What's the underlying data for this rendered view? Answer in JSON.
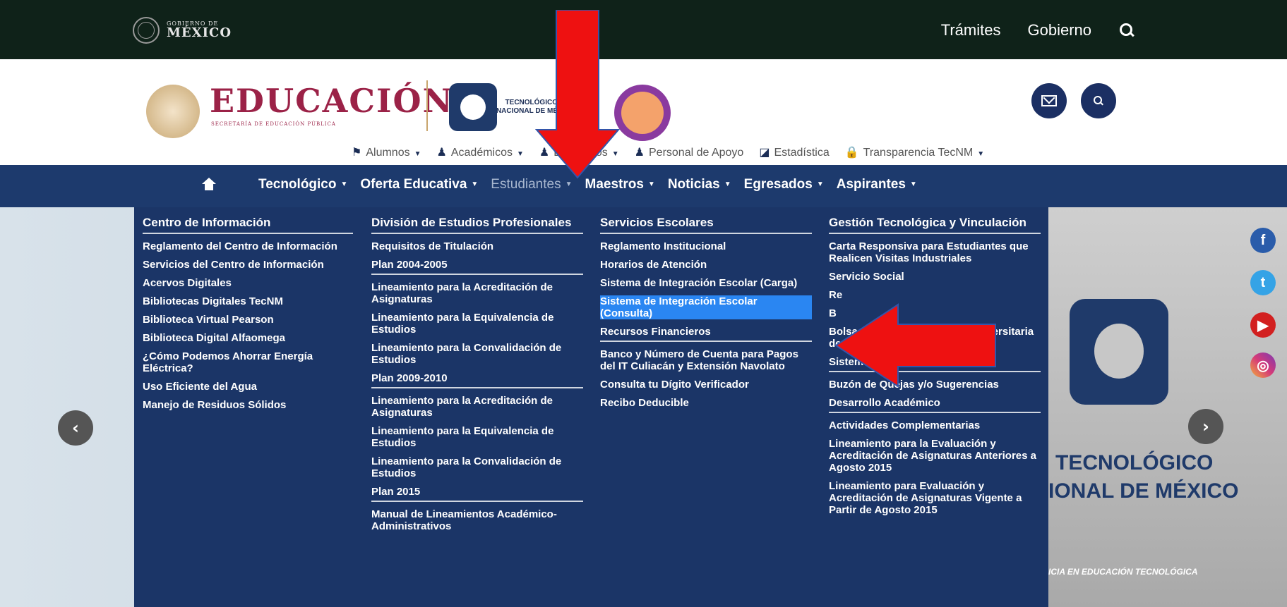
{
  "gov": {
    "logo_small": "GOBIERNO DE",
    "logo_big": "MÉXICO",
    "nav": [
      "Trámites",
      "Gobierno"
    ]
  },
  "header": {
    "edu_title": "EDUCACIÓN",
    "edu_sub": "SECRETARÍA DE EDUCACIÓN PÚBLICA",
    "tec_name": "TECNOLÓGICO NACIONAL DE MÉ"
  },
  "subnav": [
    {
      "label": "Alumnos",
      "icon": "flag-icon",
      "caret": true
    },
    {
      "label": "Académicos",
      "icon": "person-icon",
      "caret": true
    },
    {
      "label": "Egresados",
      "icon": "person-icon",
      "caret": true
    },
    {
      "label": "Personal de Apoyo",
      "icon": "person-icon",
      "caret": false
    },
    {
      "label": "Estadística",
      "icon": "chart-icon",
      "caret": false
    },
    {
      "label": "Transparencia TecNM",
      "icon": "lock-icon",
      "caret": true
    }
  ],
  "mainnav": [
    {
      "label": "Tecnológico",
      "active": false
    },
    {
      "label": "Oferta Educativa",
      "active": false
    },
    {
      "label": "Estudiantes",
      "active": true
    },
    {
      "label": "Maestros",
      "active": false
    },
    {
      "label": "Noticias",
      "active": false
    },
    {
      "label": "Egresados",
      "active": false
    },
    {
      "label": "Aspirantes",
      "active": false
    }
  ],
  "dropdown": {
    "col1": {
      "title": "Centro de Información",
      "items": [
        "Reglamento del Centro de Información",
        "Servicios del Centro de Información",
        "Acervos Digitales",
        "Bibliotecas Digitales TecNM",
        "Biblioteca Virtual Pearson",
        "Biblioteca Digital Alfaomega",
        "¿Cómo Podemos Ahorrar Energía Eléctrica?",
        "Uso Eficiente del Agua",
        "Manejo de Residuos Sólidos"
      ]
    },
    "col2": {
      "title": "División de Estudios Profesionales",
      "items": [
        {
          "t": "Requisitos de Titulación",
          "s": false
        },
        {
          "t": "Plan 2004-2005",
          "s": true
        },
        {
          "t": "Lineamiento para la Acreditación de Asignaturas",
          "s": false
        },
        {
          "t": "Lineamiento para la Equivalencia de Estudios",
          "s": false
        },
        {
          "t": "Lineamiento para la Convalidación de Estudios",
          "s": false
        },
        {
          "t": "Plan 2009-2010",
          "s": true
        },
        {
          "t": "Lineamiento para la Acreditación de Asignaturas",
          "s": false
        },
        {
          "t": "Lineamiento para la Equivalencia de Estudios",
          "s": false
        },
        {
          "t": "Lineamiento para la Convalidación de Estudios",
          "s": false
        },
        {
          "t": "Plan 2015",
          "s": true
        },
        {
          "t": "Manual de Lineamientos Académico-Administrativos",
          "s": false
        }
      ]
    },
    "col3": {
      "title": "Servicios Escolares",
      "items": [
        {
          "t": "Reglamento Institucional",
          "s": false,
          "h": false
        },
        {
          "t": "Horarios de Atención",
          "s": false,
          "h": false
        },
        {
          "t": "Sistema de Integración Escolar (Carga)",
          "s": false,
          "h": false
        },
        {
          "t": "Sistema de Integración Escolar (Consulta)",
          "s": false,
          "h": true
        },
        {
          "t": "Recursos Financieros",
          "s": true,
          "h": false
        },
        {
          "t": "Banco y Número de Cuenta para Pagos del IT Culiacán y Extensión Navolato",
          "s": false,
          "h": false
        },
        {
          "t": "Consulta tu Dígito Verificador",
          "s": false,
          "h": false
        },
        {
          "t": "Recibo Deducible",
          "s": false,
          "h": false
        }
      ]
    },
    "col4": {
      "title": "Gestión Tecnológica y Vinculación",
      "items": [
        {
          "t": "Carta Responsiva para Estudiantes que Realicen Visitas Industriales",
          "s": false
        },
        {
          "t": "Servicio Social",
          "s": false
        },
        {
          "t": "Re",
          "s": false
        },
        {
          "t": "B",
          "s": false
        },
        {
          "t": "Bolsa de Trabajo OCC (Red Universitaria de Empleo)",
          "s": false
        },
        {
          "t": "Sistema Integrado de Gestión",
          "s": true
        },
        {
          "t": "Buzón de Quejas y/o Sugerencias",
          "s": false
        },
        {
          "t": "Desarrollo Académico",
          "s": true
        },
        {
          "t": "Actividades Complementarias",
          "s": false
        },
        {
          "t": "Lineamiento para la Evaluación y Acreditación de Asignaturas Anteriores a Agosto 2015",
          "s": false
        },
        {
          "t": "Lineamiento para Evaluación y Acreditación de Asignaturas Vigente a Partir de Agosto 2015",
          "s": false
        }
      ]
    }
  },
  "hero": {
    "line1": "TECNOLÓGICO",
    "line2": "IONAL DE MÉXICO",
    "slogan": "ICIA EN EDUCACIÓN TECNOLÓGICA"
  },
  "colors": {
    "govbar": "#0f2219",
    "nav": "#1d3a6d",
    "dropdown": "#1b3567",
    "accent": "#9b2247",
    "highlight": "#2a86f2",
    "arrow": "#ee1111"
  }
}
